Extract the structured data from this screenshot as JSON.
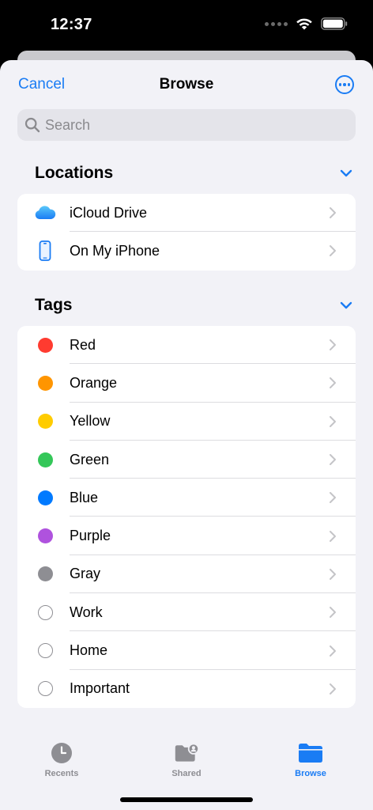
{
  "status_bar": {
    "time": "12:37"
  },
  "nav": {
    "cancel_label": "Cancel",
    "title": "Browse",
    "more_icon": "ellipsis-circle-icon"
  },
  "search": {
    "placeholder": "Search",
    "value": ""
  },
  "locations": {
    "title": "Locations",
    "items": [
      {
        "label": "iCloud Drive",
        "icon": "icloud-icon"
      },
      {
        "label": "On My iPhone",
        "icon": "iphone-icon"
      }
    ]
  },
  "tags": {
    "title": "Tags",
    "items": [
      {
        "label": "Red",
        "color": "#ff3b30"
      },
      {
        "label": "Orange",
        "color": "#ff9500"
      },
      {
        "label": "Yellow",
        "color": "#ffcc00"
      },
      {
        "label": "Green",
        "color": "#34c759"
      },
      {
        "label": "Blue",
        "color": "#007aff"
      },
      {
        "label": "Purple",
        "color": "#af52de"
      },
      {
        "label": "Gray",
        "color": "#8e8e93"
      },
      {
        "label": "Work",
        "color": ""
      },
      {
        "label": "Home",
        "color": ""
      },
      {
        "label": "Important",
        "color": ""
      }
    ]
  },
  "tabbar": {
    "tabs": [
      {
        "label": "Recents",
        "icon": "clock-icon",
        "active": false
      },
      {
        "label": "Shared",
        "icon": "shared-folder-icon",
        "active": false
      },
      {
        "label": "Browse",
        "icon": "folder-icon",
        "active": true
      }
    ]
  },
  "colors": {
    "accent": "#1a7cf4",
    "inactive": "#8e8e93",
    "background": "#f2f2f7"
  }
}
